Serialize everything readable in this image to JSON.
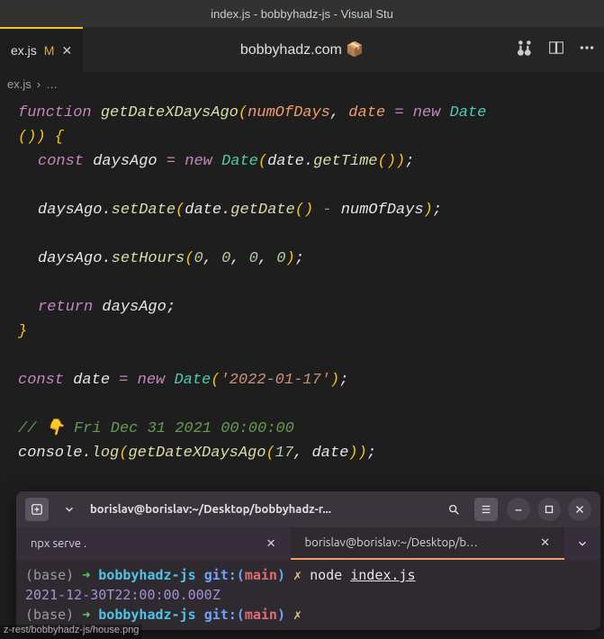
{
  "title_bar": "index.js - bobbyhadz-js - Visual Stu",
  "tab": {
    "filename": "ex.js",
    "modified_badge": "M",
    "center_text": "bobbyhadz.com 📦"
  },
  "breadcrumb": {
    "file": "ex.js",
    "sep": "›",
    "more": "…"
  },
  "code": {
    "l1_function": "function",
    "l1_name": "getDateXDaysAgo",
    "l1_p1": "numOfDays",
    "l1_comma": ",",
    "l1_p2": "date",
    "l1_eq": "=",
    "l1_new": "new",
    "l1_date": "Date",
    "l2_parens": "()",
    "l2_brace": ") {",
    "l3_const": "const",
    "l3_var": "daysAgo",
    "l3_eq": "=",
    "l3_new": "new",
    "l3_date": "Date",
    "l3_call": "(date.",
    "l3_method": "getTime",
    "l3_end": "());",
    "l4_obj": "daysAgo.",
    "l4_method": "setDate",
    "l4_open": "(date.",
    "l4_method2": "getDate",
    "l4_paren": "()",
    "l4_minus": "-",
    "l4_var": "numOfDays",
    "l4_end": ");",
    "l5_obj": "daysAgo.",
    "l5_method": "setHours",
    "l5_args": "(",
    "l5_n0": "0",
    "l5_end": ");",
    "l6_return": "return",
    "l6_var": "daysAgo",
    "l6_semi": ";",
    "l7_brace": "}",
    "l8_const": "const",
    "l8_var": "date",
    "l8_eq": "=",
    "l8_new": "new",
    "l8_date": "Date",
    "l8_str": "'2022-01-17'",
    "l8_end": ");",
    "l9_comment": "// 👇️ Fri Dec 31 2021 00:00:00",
    "l10_obj": "console.",
    "l10_log": "log",
    "l10_call": "getDateXDaysAgo",
    "l10_n": "17",
    "l10_var": "date",
    "l10_end": "));"
  },
  "terminal": {
    "title": "borislav@borislav:~/Desktop/bobbyhadz-r...",
    "tab1": "npx serve .",
    "tab2": "borislav@borislav:~/Desktop/b…",
    "line1_base": "(base)",
    "line1_arrow": "➜",
    "line1_dir": "bobbyhadz-js",
    "line1_git": "git:(",
    "line1_branch": "main",
    "line1_close": ")",
    "line1_x": "✗",
    "line1_cmd": "node",
    "line1_file": "index.js",
    "line2_output": "2021-12-30T22:00:00.000Z",
    "line3_base": "(base)",
    "line3_arrow": "➜",
    "line3_dir": "bobbyhadz-js",
    "line3_git": "git:(",
    "line3_branch": "main",
    "line3_close": ")",
    "line3_x": "✗"
  },
  "status_bar": "z-rest/bobbyhadz-js/house.png"
}
